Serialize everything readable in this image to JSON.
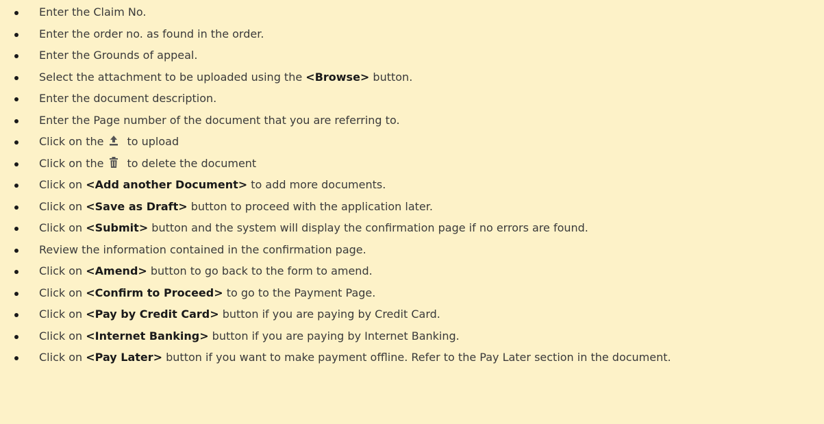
{
  "steps": [
    {
      "text": "Enter the Claim No."
    },
    {
      "text": "Enter the order no. as found in the order."
    },
    {
      "text": "Enter the Grounds of appeal."
    },
    {
      "pre": "Select the attachment to be uploaded using the ",
      "bold": "<Browse>",
      "post": " button."
    },
    {
      "text": "Enter the document description."
    },
    {
      "text": "Enter the Page number of the document that you are referring to."
    },
    {
      "pre": "Click on the",
      "icon": "upload-icon",
      "post": "to upload"
    },
    {
      "pre": "Click on the",
      "icon": "trash-icon",
      "post": "to delete the document"
    },
    {
      "pre": "Click on ",
      "bold": "<Add another Document>",
      "post": " to add more documents."
    },
    {
      "pre": "Click on ",
      "bold": "<Save as Draft>",
      "post": " button to proceed with the application later."
    },
    {
      "pre": "Click on ",
      "bold": "<Submit>",
      "post": " button and the system will display the confirmation page if no errors are found."
    },
    {
      "text": "Review the information contained in the confirmation page."
    },
    {
      "pre": "Click on ",
      "bold": "<Amend>",
      "post": " button to go back to the form to amend."
    },
    {
      "pre": "Click on ",
      "bold": "<Confirm to Proceed>",
      "post": " to go to the Payment Page."
    },
    {
      "pre": "Click on ",
      "bold": "<Pay by Credit Card>",
      "post": " button if you are paying by Credit Card."
    },
    {
      "pre": "Click on ",
      "bold": "<Internet Banking>",
      "post": " button if you are paying by Internet Banking."
    },
    {
      "pre": "Click on ",
      "bold": "<Pay Later>",
      "post": " button if you want to make payment offline.  Refer to the Pay Later section in the document."
    }
  ],
  "colors": {
    "background": "#fdf2c8",
    "text": "#3a3a3a",
    "icon": "#555555"
  }
}
